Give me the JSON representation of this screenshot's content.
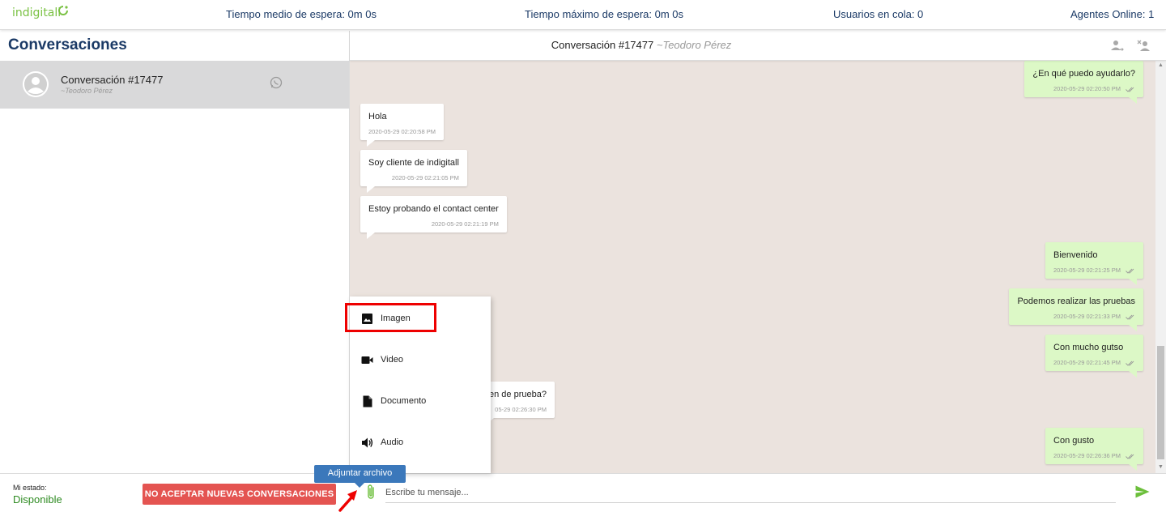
{
  "brand": {
    "name": "indigitall",
    "color": "#7ac143"
  },
  "stats": {
    "avg_wait": "Tiempo medio de espera: 0m 0s",
    "max_wait": "Tiempo máximo de espera: 0m 0s",
    "queue": "Usuarios en cola: 0",
    "agents": "Agentes Online: 1"
  },
  "sidebar": {
    "title": "Conversaciones",
    "items": [
      {
        "title": "Conversación #17477",
        "subtitle": "~Teodoro Pérez",
        "channel_icon": "whatsapp-icon"
      }
    ]
  },
  "chat": {
    "title": "Conversación #17477",
    "user": "~Teodoro Pérez",
    "header_icons": [
      "transfer-user-icon",
      "close-user-icon"
    ],
    "messages": [
      {
        "dir": "out",
        "text": "¿En qué puedo ayudarlo?",
        "time": "2020-05-29 02:20:50 PM"
      },
      {
        "dir": "in",
        "text": "Hola",
        "time": "2020-05-29 02:20:58 PM"
      },
      {
        "dir": "in",
        "text": "Soy cliente de indigitall",
        "time": "2020-05-29 02:21:05 PM"
      },
      {
        "dir": "in",
        "text": "Estoy probando el contact center",
        "time": "2020-05-29 02:21:19 PM"
      },
      {
        "dir": "out",
        "text": "Bienvenido",
        "time": "2020-05-29 02:21:25 PM"
      },
      {
        "dir": "out",
        "text": "Podemos realizar las pruebas",
        "time": "2020-05-29 02:21:33 PM"
      },
      {
        "dir": "out",
        "text": "Con mucho gutso",
        "time": "2020-05-29 02:21:45 PM"
      },
      {
        "dir": "in",
        "text": "en de prueba?",
        "time": "05-29 02:26:30 PM"
      },
      {
        "dir": "out",
        "text": "Con gusto",
        "time": "2020-05-29 02:26:36 PM"
      }
    ]
  },
  "attach_menu": {
    "items": [
      {
        "label": "Imagen",
        "icon": "image-icon"
      },
      {
        "label": "Video",
        "icon": "video-icon"
      },
      {
        "label": "Documento",
        "icon": "document-icon"
      },
      {
        "label": "Audio",
        "icon": "audio-icon"
      }
    ],
    "tooltip": "Adjuntar archivo"
  },
  "footer": {
    "state_label": "Mi estado:",
    "state_value": "Disponible",
    "no_accept_label": "NO ACEPTAR NUEVAS CONVERSACIONES",
    "input_placeholder": "Escribe tu mensaje...",
    "send_icon": "send-icon"
  },
  "colors": {
    "navy": "#1b3a66",
    "green": "#2e8b22",
    "outgoing_bubble": "#dcf8c6",
    "chat_background": "#ebe3de",
    "danger": "#e45451",
    "tooltip": "#3b78bb"
  }
}
